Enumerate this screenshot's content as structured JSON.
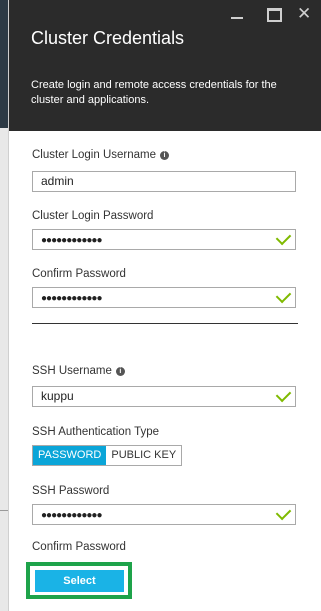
{
  "window": {
    "minimize_icon": "minimize-icon",
    "maximize_icon": "maximize-icon",
    "close_icon": "close-icon",
    "close_glyph": "✕"
  },
  "header": {
    "title": "Cluster Credentials",
    "description": "Create login and remote access credentials for the cluster and applications."
  },
  "form": {
    "cluster_login_username": {
      "label": "Cluster Login Username",
      "value": "admin"
    },
    "cluster_login_password": {
      "label": "Cluster Login Password",
      "value": "●●●●●●●●●●●●"
    },
    "confirm_password": {
      "label": "Confirm Password",
      "value": "●●●●●●●●●●●●"
    },
    "ssh_username": {
      "label": "SSH Username",
      "value": "kuppu"
    },
    "ssh_auth_type": {
      "label": "SSH Authentication Type",
      "options": [
        "PASSWORD",
        "PUBLIC KEY"
      ],
      "selected": "PASSWORD"
    },
    "ssh_password": {
      "label": "SSH Password",
      "value": "●●●●●●●●●●●●"
    },
    "ssh_confirm_password": {
      "label": "Confirm Password"
    }
  },
  "footer": {
    "select_label": "Select"
  },
  "colors": {
    "header_bg": "#2b2b2b",
    "accent": "#1ab3e6",
    "check": "#7fba00",
    "highlight": "#1ea34a"
  }
}
